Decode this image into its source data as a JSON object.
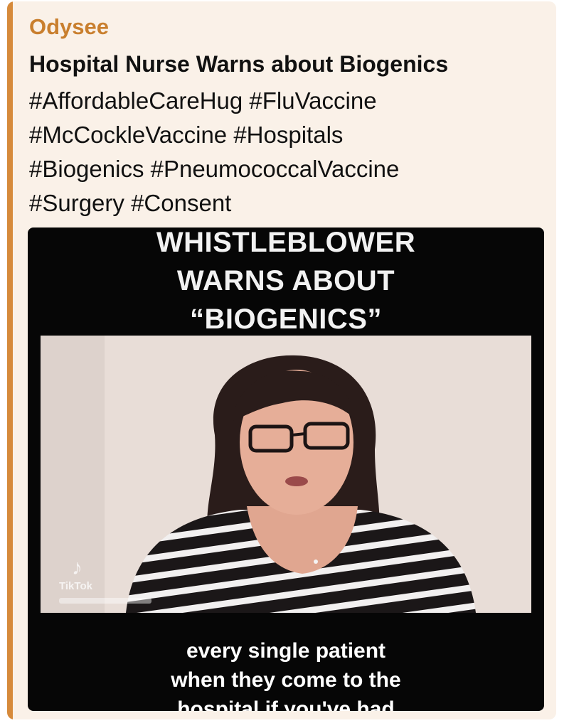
{
  "post": {
    "source": "Odysee",
    "title": "Hospital Nurse Warns about Biogenics",
    "hashtag_lines": [
      "#AffordableCareHug #FluVaccine",
      "#McCockleVaccine #Hospitals",
      "#Biogenics #PneumococcalVaccine",
      "#Surgery #Consent"
    ],
    "accent_color": "#d68a3b",
    "card_background": "#faf1e8"
  },
  "video": {
    "headline_lines": [
      "WHISTLEBLOWER",
      "WARNS ABOUT",
      "“BIOGENICS”"
    ],
    "watermark": {
      "icon": "tiktok-icon",
      "label": "TikTok"
    },
    "caption_lines": [
      "every single patient",
      "when they come to the",
      "hospital if you've had"
    ]
  }
}
